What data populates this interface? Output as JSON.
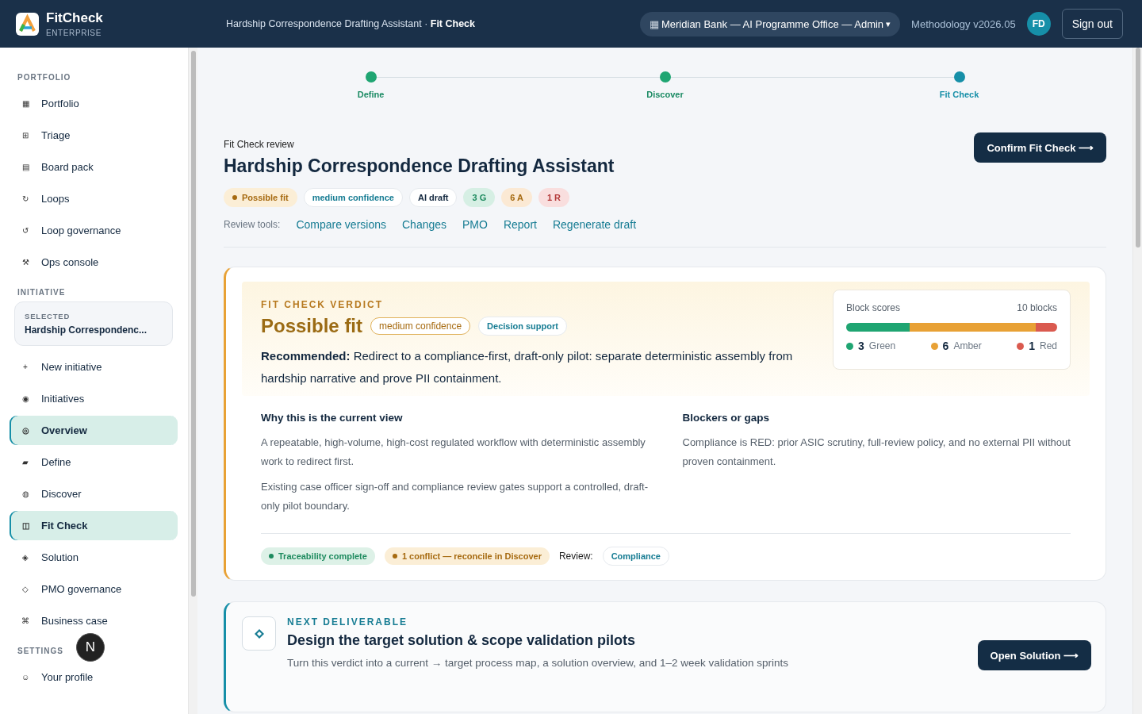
{
  "header": {
    "brand": "FitCheck",
    "edition": "ENTERPRISE",
    "context": "Hardship Correspondence Drafting Assistant · **Fit Check**",
    "org_icon": "▦",
    "org": "Meridian Bank — AI Programme Office — Admin",
    "org_caret": "▾",
    "methodology": "Methodology v2026.05",
    "avatar": "FD",
    "sign_out": "Sign out"
  },
  "sidebar": {
    "sections": [
      {
        "title": "PORTFOLIO",
        "items": [
          {
            "icon": "▦",
            "label": "Portfolio",
            "selected": false
          },
          {
            "icon": "⊞",
            "label": "Triage",
            "selected": false
          },
          {
            "icon": "▤",
            "label": "Board pack",
            "selected": false
          },
          {
            "icon": "↻",
            "label": "Loops",
            "selected": false
          },
          {
            "icon": "↺",
            "label": "Loop governance",
            "selected": false
          },
          {
            "icon": "⚒",
            "label": "Ops console",
            "selected": false
          }
        ]
      },
      {
        "title": "INITIATIVE",
        "selected_card": {
          "caption": "SELECTED",
          "name": "Hardship Correspondenc..."
        },
        "items": [
          {
            "icon": "+",
            "label": "New initiative",
            "selected": false
          },
          {
            "icon": "◉",
            "label": "Initiatives",
            "selected": false
          },
          {
            "icon": "◎",
            "label": "Overview",
            "selected": true
          },
          {
            "icon": "▰",
            "label": "Define",
            "selected": false
          },
          {
            "icon": "◍",
            "label": "Discover",
            "selected": false
          },
          {
            "icon": "◫",
            "label": "Fit Check",
            "selected": true
          },
          {
            "icon": "◈",
            "label": "Solution",
            "selected": false
          },
          {
            "icon": "◇",
            "label": "PMO governance",
            "selected": false
          },
          {
            "icon": "⌘",
            "label": "Business case",
            "selected": false
          }
        ]
      },
      {
        "title": "SETTINGS",
        "items": [
          {
            "icon": "☺",
            "label": "Your profile",
            "selected": false
          }
        ]
      }
    ],
    "dev_badge": "N"
  },
  "stepper": [
    {
      "label": "Define",
      "selected": false
    },
    {
      "label": "Discover",
      "selected": false
    },
    {
      "label": "Fit Check",
      "selected": true
    }
  ],
  "review": {
    "eyebrow": "Fit Check review",
    "title": "Hardship Correspondence Drafting Assistant",
    "confirm": "Confirm Fit Check ⟶",
    "chips": [
      {
        "label": "Possible fit",
        "kind": "fit"
      },
      {
        "label": "medium confidence",
        "kind": "confidence"
      },
      {
        "label": "AI draft",
        "kind": "plain"
      },
      {
        "label": "3 G",
        "kind": "green"
      },
      {
        "label": "6 A",
        "kind": "amber"
      },
      {
        "label": "1 R",
        "kind": "red"
      }
    ],
    "tools_label": "Review tools:",
    "tools": [
      "Compare versions",
      "Changes",
      "PMO",
      "Report",
      "Regenerate draft"
    ]
  },
  "verdict": {
    "eyebrow": "FIT CHECK VERDICT",
    "title": "Possible fit",
    "confidence": "medium confidence",
    "mode": "Decision support",
    "recommendation": "**Recommended:** Redirect to a compliance-first, draft-only pilot: separate deterministic assembly from hardship narrative and prove PII containment.",
    "scores": {
      "title": "Block scores",
      "total": "10 blocks",
      "segments": [
        {
          "count": "3",
          "label": "Green",
          "color": "#1fa572"
        },
        {
          "count": "6",
          "label": "Amber",
          "color": "#e8a135"
        },
        {
          "count": "1",
          "label": "Red",
          "color": "#da5a4f"
        }
      ]
    },
    "columns": [
      {
        "title": "Why this is the current view",
        "paragraphs": [
          "A repeatable, high-volume, high-cost regulated workflow with deterministic assembly work to redirect first.",
          "Existing case officer sign-off and compliance review gates support a controlled, draft-only pilot boundary."
        ]
      },
      {
        "title": "Blockers or gaps",
        "paragraphs": [
          "Compliance is RED: prior ASIC scrutiny, full-review policy, and no external PII without proven containment."
        ]
      }
    ],
    "footer": {
      "traceability": "Traceability complete",
      "conflict": "1 conflict — reconcile in Discover",
      "review_label": "Review:",
      "review_value": "Compliance"
    }
  },
  "next": {
    "eyebrow": "NEXT DELIVERABLE",
    "title": "Design the target solution & scope validation pilots",
    "text": "Turn this verdict into a current → target process map, a solution overview, and 1–2 week validation sprints",
    "button": "Open Solution ⟶"
  }
}
